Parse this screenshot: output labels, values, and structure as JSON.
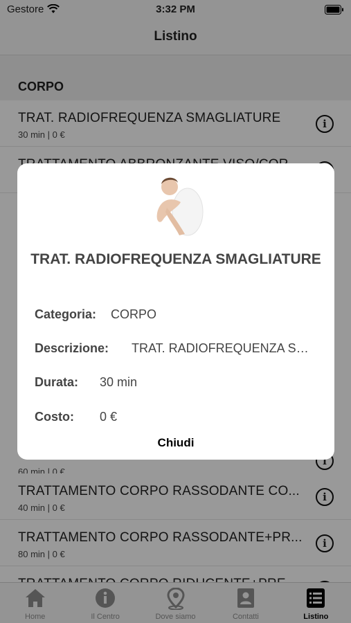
{
  "status_bar": {
    "carrier": "Gestore",
    "time": "3:32 PM"
  },
  "nav": {
    "title": "Listino"
  },
  "list": {
    "section_title": "CORPO",
    "rows": [
      {
        "title": "TRAT. RADIOFREQUENZA SMAGLIATURE",
        "sub": "30 min | 0 €"
      },
      {
        "title": "TRATTAMENTO ABBRONZANTE VISO/COR...",
        "sub": ""
      },
      {
        "title": "",
        "sub": "60 min | 0 €"
      },
      {
        "title": "TRATTAMENTO CORPO RASSODANTE CO...",
        "sub": "40 min | 0 €"
      },
      {
        "title": "TRATTAMENTO CORPO RASSODANTE+PR...",
        "sub": "80 min | 0 €"
      },
      {
        "title": "TRATTAMENTO CORPO RIDUCENTE+PRE...",
        "sub": ""
      }
    ]
  },
  "modal": {
    "title": "TRAT. RADIOFREQUENZA SMAGLIATURE",
    "categoria_label": "Categoria:",
    "categoria_value": "CORPO",
    "descrizione_label": "Descrizione:",
    "descrizione_value": "TRAT. RADIOFREQUENZA SMAGLIATURE",
    "durata_label": "Durata:",
    "durata_value": "30 min",
    "costo_label": "Costo:",
    "costo_value": "0 €",
    "close_label": "Chiudi"
  },
  "tab_bar": {
    "tabs": [
      {
        "label": "Home",
        "icon": "home-icon"
      },
      {
        "label": "Il Centro",
        "icon": "info-icon"
      },
      {
        "label": "Dove siamo",
        "icon": "map-pin-icon"
      },
      {
        "label": "Contatti",
        "icon": "contacts-icon"
      },
      {
        "label": "Listino",
        "icon": "list-icon",
        "active": true
      }
    ]
  },
  "colors": {
    "overlay": "#000000",
    "modal_bg": "#ffffff",
    "active_tab": "#000000",
    "inactive_tab": "#8e8e8e"
  }
}
